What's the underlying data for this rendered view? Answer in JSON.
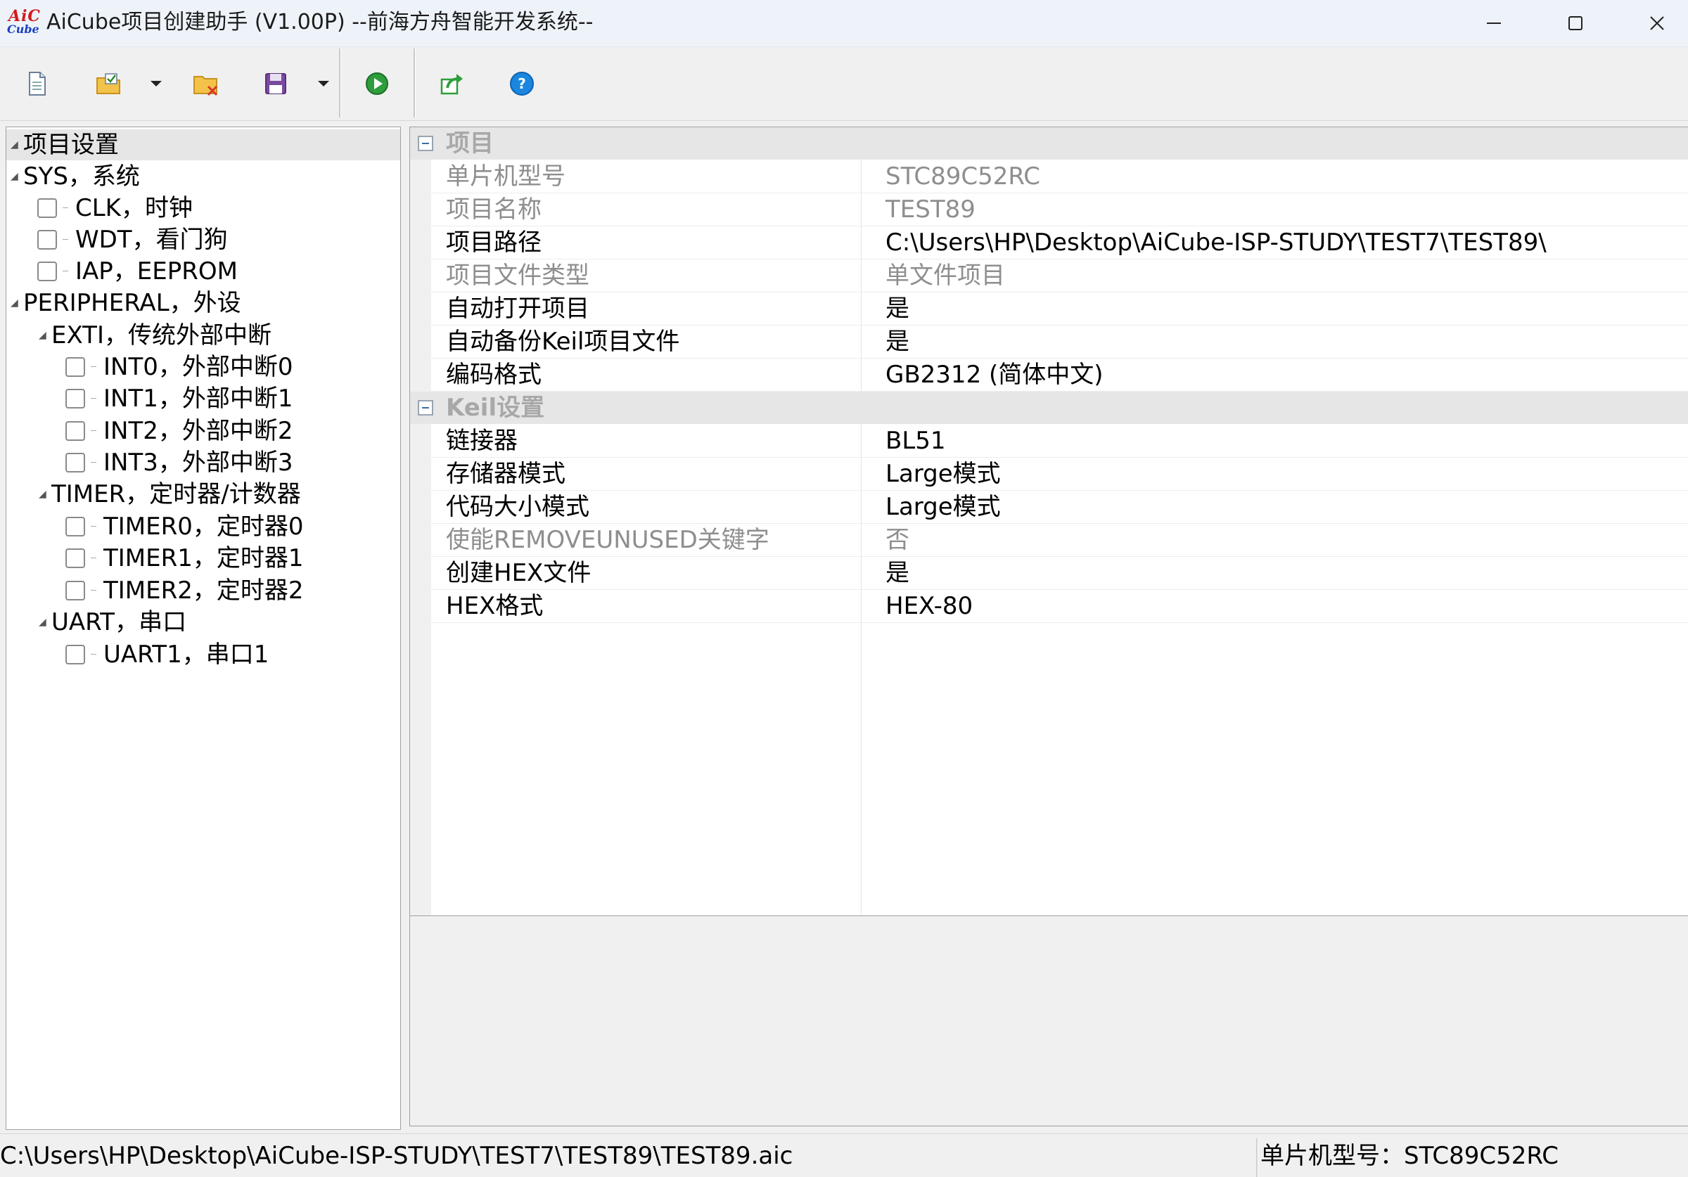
{
  "window": {
    "logo_top": "AiC",
    "logo_bottom": "Cube",
    "title": "AiCube项目创建助手 (V1.00P) --前海方舟智能开发系统--"
  },
  "toolbar": {
    "buttons": [
      {
        "name": "new-project",
        "icon": "new-document-icon"
      },
      {
        "name": "open-project",
        "icon": "open-folder-icon",
        "has_dropdown": true
      },
      {
        "name": "close-project",
        "icon": "close-folder-icon"
      },
      {
        "name": "save-project",
        "icon": "save-disk-icon",
        "has_dropdown": true
      },
      {
        "name": "run",
        "icon": "play-icon"
      },
      {
        "name": "export",
        "icon": "export-icon"
      },
      {
        "name": "help",
        "icon": "help-icon"
      }
    ]
  },
  "tree": {
    "root": "项目设置",
    "sys": "SYS，系统",
    "clk": "CLK，时钟",
    "wdt": "WDT，看门狗",
    "iap": "IAP，EEPROM",
    "peripheral": "PERIPHERAL，外设",
    "exti": "EXTI，传统外部中断",
    "int0": "INT0，外部中断0",
    "int1": "INT1，外部中断1",
    "int2": "INT2，外部中断2",
    "int3": "INT3，外部中断3",
    "timer": "TIMER，定时器/计数器",
    "timer0": "TIMER0，定时器0",
    "timer1": "TIMER1，定时器1",
    "timer2": "TIMER2，定时器2",
    "uart": "UART，串口",
    "uart1": "UART1，串口1"
  },
  "grid": {
    "project_category": "项目",
    "project_props": [
      {
        "name": "单片机型号",
        "value": "STC89C52RC",
        "enabled": false
      },
      {
        "name": "项目名称",
        "value": "TEST89",
        "enabled": false
      },
      {
        "name": "项目路径",
        "value": "C:\\Users\\HP\\Desktop\\AiCube-ISP-STUDY\\TEST7\\TEST89\\",
        "enabled": true
      },
      {
        "name": "项目文件类型",
        "value": "单文件项目",
        "enabled": false
      },
      {
        "name": "自动打开项目",
        "value": "是",
        "enabled": true
      },
      {
        "name": "自动备份Keil项目文件",
        "value": "是",
        "enabled": true
      },
      {
        "name": "编码格式",
        "value": "GB2312 (简体中文)",
        "enabled": true
      }
    ],
    "keil_category": "Keil设置",
    "keil_props": [
      {
        "name": "链接器",
        "value": "BL51",
        "enabled": true
      },
      {
        "name": "存储器模式",
        "value": "Large模式",
        "enabled": true
      },
      {
        "name": "代码大小模式",
        "value": "Large模式",
        "enabled": true
      },
      {
        "name": "使能REMOVEUNUSED关键字",
        "value": "否",
        "enabled": false
      },
      {
        "name": "创建HEX文件",
        "value": "是",
        "enabled": true
      },
      {
        "name": "HEX格式",
        "value": "HEX-80",
        "enabled": true
      }
    ]
  },
  "status": {
    "path": "C:\\Users\\HP\\Desktop\\AiCube-ISP-STUDY\\TEST7\\TEST89\\TEST89.aic",
    "mcu": "单片机型号：STC89C52RC"
  }
}
